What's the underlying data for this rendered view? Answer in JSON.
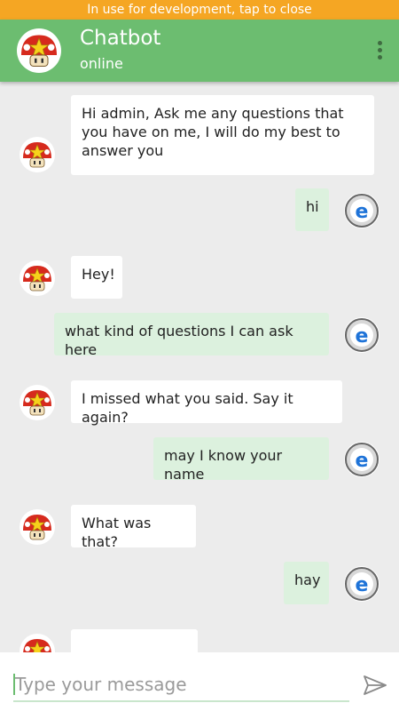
{
  "dev_banner": "In use for development, tap to close",
  "header": {
    "title": "Chatbot",
    "status": "online"
  },
  "messages": [
    {
      "sender": "bot",
      "text": "Hi admin, Ask me any questions that you have on me, I will do my best to answer you"
    },
    {
      "sender": "user",
      "text": "hi"
    },
    {
      "sender": "bot",
      "text": "Hey!"
    },
    {
      "sender": "user",
      "text": "what kind of questions I can ask here"
    },
    {
      "sender": "bot",
      "text": "I missed what you said. Say it again?"
    },
    {
      "sender": "user",
      "text": "may I know your name"
    },
    {
      "sender": "bot",
      "text": "What was that?"
    },
    {
      "sender": "user",
      "text": "hay"
    }
  ],
  "composer": {
    "placeholder": "Type your message"
  },
  "icons": {
    "bot_avatar": "mushroom-star-icon",
    "user_avatar": "browser-e-icon",
    "menu": "more-vert-icon",
    "send": "send-icon"
  },
  "colors": {
    "app_bar": "#6cbd70",
    "dev_banner": "#f5a623",
    "bot_bubble": "#ffffff",
    "user_bubble": "#dcf1de",
    "background": "#ececec"
  }
}
